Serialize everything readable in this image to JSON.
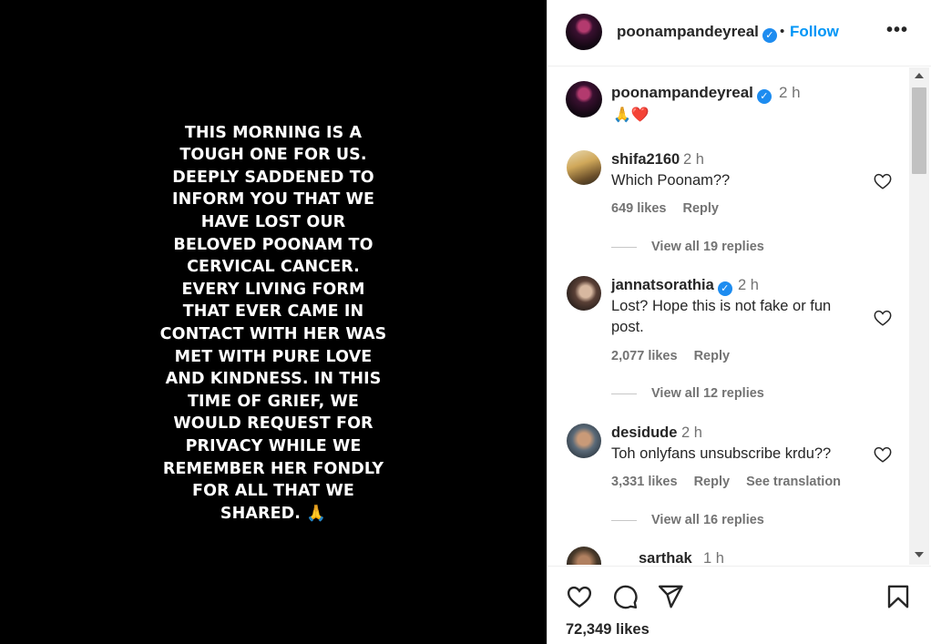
{
  "story": {
    "lines": [
      "THIS MORNING IS A",
      "TOUGH ONE FOR US.",
      "DEEPLY SADDENED TO",
      "INFORM YOU THAT WE",
      "HAVE LOST OUR",
      "BELOVED POONAM TO",
      "CERVICAL CANCER.",
      "EVERY LIVING FORM",
      "THAT EVER CAME IN",
      "CONTACT WITH HER WAS",
      "MET WITH PURE LOVE",
      "AND KINDNESS. IN THIS",
      "TIME OF GRIEF, WE",
      "WOULD REQUEST FOR",
      "PRIVACY WHILE WE",
      "REMEMBER HER FONDLY",
      "FOR ALL THAT WE",
      "SHARED. 🙏"
    ]
  },
  "header": {
    "username": "poonampandeyreal",
    "verified_mark": "✓",
    "dot": "•",
    "follow_label": "Follow",
    "more_label": "•••"
  },
  "caption": {
    "username": "poonampandeyreal",
    "verified_mark": "✓",
    "time": "2 h",
    "text": "🙏❤️"
  },
  "comments": [
    {
      "username": "shifa2160",
      "time": "2 h",
      "text": "Which Poonam??",
      "likes": "649 likes",
      "reply_label": "Reply",
      "replies": "View all 19 replies"
    },
    {
      "username": "jannatsorathia",
      "verified_mark": "✓",
      "time": "2 h",
      "text": "Lost? Hope this is not fake or fun post.",
      "likes": "2,077 likes",
      "reply_label": "Reply",
      "replies": "View all 12 replies"
    },
    {
      "username": "desidude",
      "time": "2 h",
      "text": "Toh onlyfans unsubscribe krdu??",
      "likes": "3,331 likes",
      "reply_label": "Reply",
      "translation_label": "See translation",
      "replies": "View all 16 replies"
    },
    {
      "username": "sarthak",
      "time": "1 h"
    }
  ],
  "footer": {
    "likes": "72,349 likes"
  }
}
